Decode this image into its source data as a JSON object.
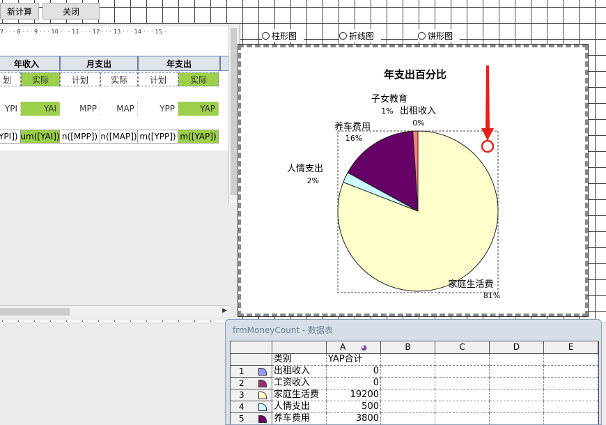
{
  "toolbar": {
    "recalc_label": "新计算",
    "close_label": "关闭"
  },
  "ruler": {
    "text": "7 · · · 8 · · · 9 · · · 10 · · · 11 · · · 12 · · · 13 · · · 14 · · · 15 ·"
  },
  "subform": {
    "group_headers": [
      "年收入",
      "月支出",
      "年支出"
    ],
    "sub_headers": [
      "划",
      "实际",
      "计划",
      "实际",
      "计划",
      "实际"
    ],
    "fields": [
      "YPI",
      "YAI",
      "MPP",
      "MAP",
      "YPP",
      "YAP"
    ],
    "sums": [
      "[YPI])",
      "um([YAI])",
      "n([MPP])",
      "n([MAP])",
      "m([YPP])",
      "m([YAP])"
    ]
  },
  "chart_options": [
    "柱形图",
    "折线图",
    "饼形图"
  ],
  "chart_data": {
    "type": "pie",
    "title": "年支出百分比",
    "slices": [
      {
        "label": "家庭生活费",
        "percent_label": "81%",
        "value": 19200,
        "color": "#ffffcc"
      },
      {
        "label": "人情支出",
        "percent_label": "2%",
        "value": 500,
        "color": "#ccffff"
      },
      {
        "label": "养车费用",
        "percent_label": "16%",
        "value": 3800,
        "color": "#660066"
      },
      {
        "label": "子女教育",
        "percent_label": "1%",
        "value": 240,
        "color": "#ff8080"
      },
      {
        "label": "出租收入",
        "percent_label": "0%",
        "value": 0,
        "color": "#9999ff"
      }
    ]
  },
  "datasheet": {
    "title": "frmMoneyCount - 数据表",
    "columns": [
      "A",
      "B",
      "C",
      "D",
      "E"
    ],
    "header_row": {
      "category": "类别",
      "value_label": "YAP合计"
    },
    "rows": [
      {
        "num": "1",
        "category": "出租收入",
        "value": "0",
        "color": "#9999ff"
      },
      {
        "num": "2",
        "category": "工资收入",
        "value": "0",
        "color": "#993366"
      },
      {
        "num": "3",
        "category": "家庭生活费",
        "value": "19200",
        "color": "#ffffcc"
      },
      {
        "num": "4",
        "category": "人情支出",
        "value": "500",
        "color": "#ccffff"
      },
      {
        "num": "5",
        "category": "养车费用",
        "value": "3800",
        "color": "#660066"
      }
    ]
  },
  "annotation": {
    "arrow_color": "#e8201c"
  }
}
